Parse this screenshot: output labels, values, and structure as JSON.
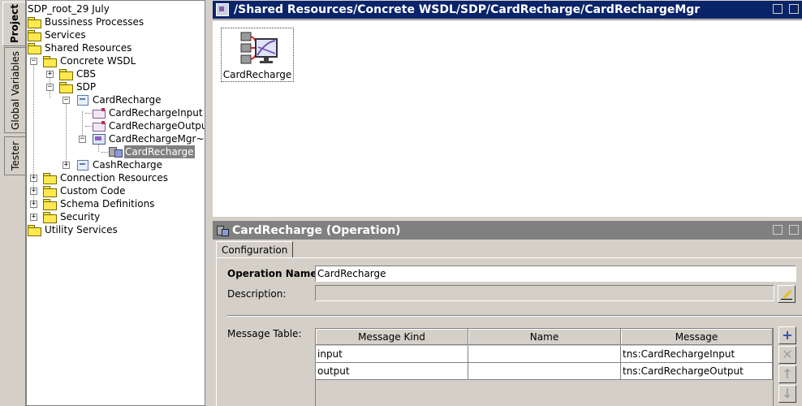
{
  "side_tabs": [
    "Project",
    "Global Variables",
    "Tester"
  ],
  "tree": {
    "nodes": [
      {
        "label": "SDP_root_29 July"
      },
      {
        "label": "Bussiness Processes"
      },
      {
        "label": "Services"
      },
      {
        "label": "Shared Resources"
      },
      {
        "label": "Concrete WSDL"
      },
      {
        "label": "CBS"
      },
      {
        "label": "SDP"
      },
      {
        "label": "CardRecharge"
      },
      {
        "label": "CardRechargeInput"
      },
      {
        "label": "CardRechargeOutput"
      },
      {
        "label": "CardRechargeMgr~"
      },
      {
        "label": "CardRecharge"
      },
      {
        "label": "CashRecharge"
      },
      {
        "label": "Connection Resources"
      },
      {
        "label": "Custom Code"
      },
      {
        "label": "Schema Definitions"
      },
      {
        "label": "Security"
      },
      {
        "label": "Utility Services"
      }
    ],
    "selected": "CardRecharge"
  },
  "top_pane": {
    "title": "/Shared Resources/Concrete WSDL/SDP/CardRecharge/CardRechargeMgr",
    "operation_label": "CardRecharge"
  },
  "bottom_pane": {
    "title": "CardRecharge (Operation)",
    "tab": "Configuration",
    "operation_name_label": "Operation Name:",
    "operation_name_value": "CardRecharge",
    "description_label": "Description:",
    "description_value": "",
    "message_table_label": "Message Table:",
    "table": {
      "columns": [
        "Message Kind",
        "Name",
        "Message"
      ],
      "rows": [
        [
          "input",
          "",
          "tns:CardRechargeInput"
        ],
        [
          "output",
          "",
          "tns:CardRechargeOutput"
        ]
      ]
    }
  },
  "colors": {
    "active_title_bar": "#0a246a",
    "inactive_title_bar": "#808080",
    "window_face": "#d4d0c8",
    "selection": "#808080"
  }
}
